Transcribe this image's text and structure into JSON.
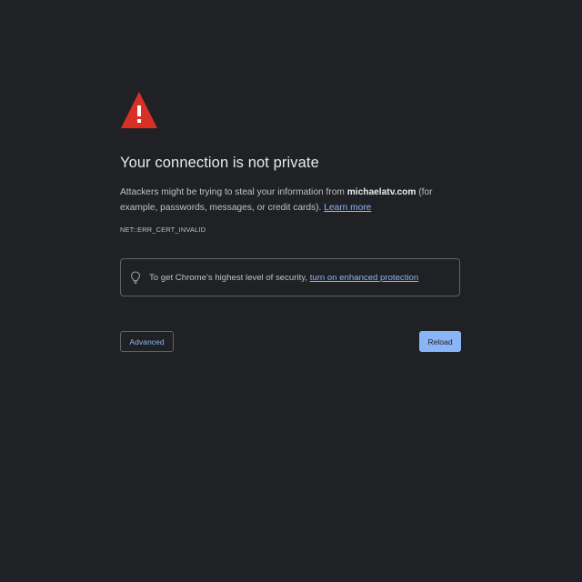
{
  "page": {
    "background": "#202124",
    "text_color": "#bdc1c6",
    "heading_color": "#e8eaed",
    "link_color": "#8ab4f8",
    "warning_color": "#d93025"
  },
  "warning": {
    "icon": "warning-triangle-icon"
  },
  "heading": "Your connection is not private",
  "explanation": {
    "prefix": "Attackers might be trying to steal your information from ",
    "domain": "michaelatv.com",
    "suffix": " (for example, passwords, messages, or credit cards). ",
    "learn_more": "Learn more"
  },
  "error_code": "NET::ERR_CERT_INVALID",
  "enhanced_protection": {
    "icon": "lightbulb-icon",
    "text": "To get Chrome’s highest level of security, ",
    "link": "turn on enhanced protection"
  },
  "buttons": {
    "advanced": "Advanced",
    "reload": "Reload"
  }
}
